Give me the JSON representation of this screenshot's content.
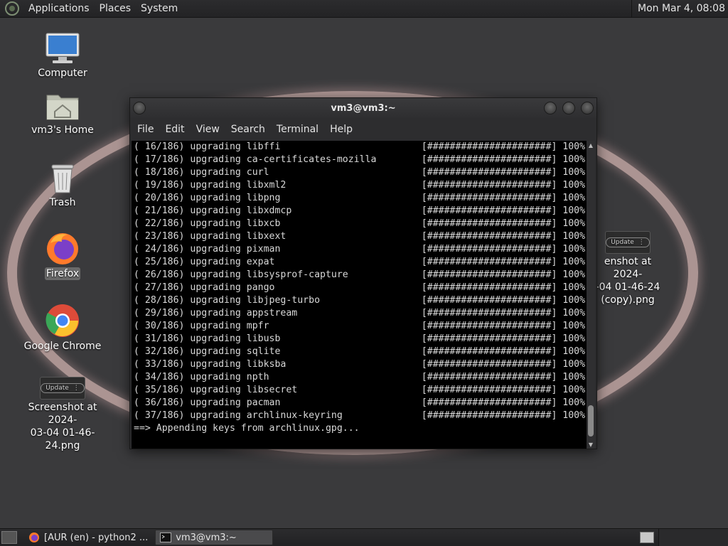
{
  "top_panel": {
    "menus": [
      "Applications",
      "Places",
      "System"
    ],
    "clock": "Mon Mar  4, 08:08"
  },
  "desktop_icons": {
    "computer": "Computer",
    "home": "vm3's Home",
    "trash": "Trash",
    "firefox": "Firefox",
    "chrome": "Google Chrome",
    "screenshot_left": "Screenshot at 2024-\n03-04 01-46-24.png",
    "screenshot_right": "enshot at 2024-\n-04 01-46-24\n(copy).png",
    "thumb_label": "Update"
  },
  "terminal": {
    "title": "vm3@vm3:~",
    "menus": [
      "File",
      "Edit",
      "View",
      "Search",
      "Terminal",
      "Help"
    ],
    "progress_bar": "[######################]",
    "lines": [
      {
        "idx": "( 16/186)",
        "pkg": "libffi",
        "pct": "100%"
      },
      {
        "idx": "( 17/186)",
        "pkg": "ca-certificates-mozilla",
        "pct": "100%"
      },
      {
        "idx": "( 18/186)",
        "pkg": "curl",
        "pct": "100%"
      },
      {
        "idx": "( 19/186)",
        "pkg": "libxml2",
        "pct": "100%"
      },
      {
        "idx": "( 20/186)",
        "pkg": "libpng",
        "pct": "100%"
      },
      {
        "idx": "( 21/186)",
        "pkg": "libxdmcp",
        "pct": "100%"
      },
      {
        "idx": "( 22/186)",
        "pkg": "libxcb",
        "pct": "100%"
      },
      {
        "idx": "( 23/186)",
        "pkg": "libxext",
        "pct": "100%"
      },
      {
        "idx": "( 24/186)",
        "pkg": "pixman",
        "pct": "100%"
      },
      {
        "idx": "( 25/186)",
        "pkg": "expat",
        "pct": "100%"
      },
      {
        "idx": "( 26/186)",
        "pkg": "libsysprof-capture",
        "pct": "100%"
      },
      {
        "idx": "( 27/186)",
        "pkg": "pango",
        "pct": "100%"
      },
      {
        "idx": "( 28/186)",
        "pkg": "libjpeg-turbo",
        "pct": "100%"
      },
      {
        "idx": "( 29/186)",
        "pkg": "appstream",
        "pct": "100%"
      },
      {
        "idx": "( 30/186)",
        "pkg": "mpfr",
        "pct": "100%"
      },
      {
        "idx": "( 31/186)",
        "pkg": "libusb",
        "pct": "100%"
      },
      {
        "idx": "( 32/186)",
        "pkg": "sqlite",
        "pct": "100%"
      },
      {
        "idx": "( 33/186)",
        "pkg": "libksba",
        "pct": "100%"
      },
      {
        "idx": "( 34/186)",
        "pkg": "npth",
        "pct": "100%"
      },
      {
        "idx": "( 35/186)",
        "pkg": "libsecret",
        "pct": "100%"
      },
      {
        "idx": "( 36/186)",
        "pkg": "pacman",
        "pct": "100%"
      },
      {
        "idx": "( 37/186)",
        "pkg": "archlinux-keyring",
        "pct": "100%"
      }
    ],
    "verb": "upgrading",
    "final_line": "==> Appending keys from archlinux.gpg..."
  },
  "taskbar": {
    "tasks": [
      "[AUR (en) - python2 ...",
      "vm3@vm3:~"
    ]
  },
  "colors": {
    "panel_bg": "#2c2c2e",
    "desktop_bg": "#3a3a3c",
    "terminal_bg": "#000000",
    "ring": "#b89e9c"
  }
}
